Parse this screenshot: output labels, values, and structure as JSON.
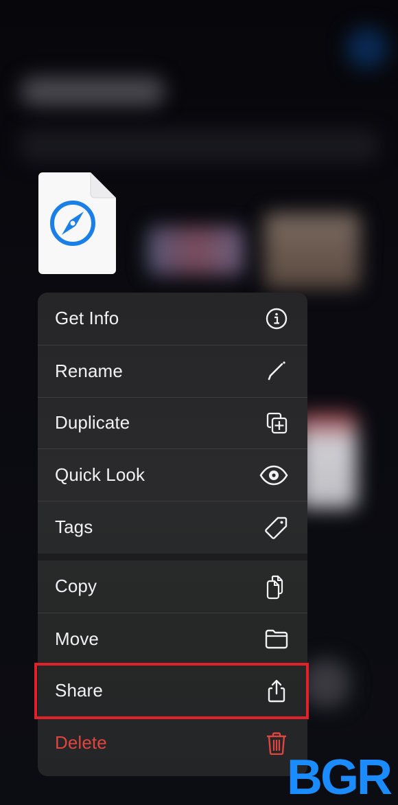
{
  "background": {
    "blurred_title": "",
    "note": "blurred Files app Recents view behind menu"
  },
  "file": {
    "icon": "safari-compass-icon",
    "accent": "#1a7fe6"
  },
  "menu": {
    "groups": [
      {
        "items": [
          {
            "label": "Get Info",
            "icon": "info-circle-icon"
          },
          {
            "label": "Rename",
            "icon": "pencil-icon"
          },
          {
            "label": "Duplicate",
            "icon": "duplicate-plus-icon"
          },
          {
            "label": "Quick Look",
            "icon": "eye-icon"
          },
          {
            "label": "Tags",
            "icon": "tag-icon"
          }
        ]
      },
      {
        "items": [
          {
            "label": "Copy",
            "icon": "copy-documents-icon"
          },
          {
            "label": "Move",
            "icon": "folder-icon"
          },
          {
            "label": "Share",
            "icon": "share-icon",
            "highlighted": true
          },
          {
            "label": "Delete",
            "icon": "trash-icon",
            "destructive": true
          }
        ]
      }
    ]
  },
  "colors": {
    "destructive": "#e0453f",
    "highlight_box": "#e3212b",
    "logo": "#1a8cff"
  },
  "watermark": {
    "text": "BGR"
  }
}
